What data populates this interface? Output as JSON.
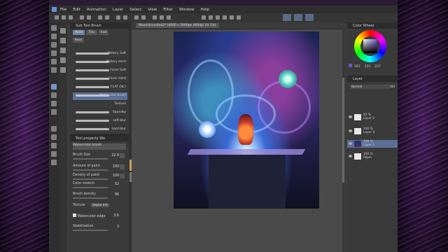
{
  "menu": [
    "File",
    "Edit",
    "Animation",
    "Layer",
    "Select",
    "View",
    "Filter",
    "Window",
    "Help"
  ],
  "subtool": {
    "title": "Sub Tool Brush",
    "tabs": [
      "Wate",
      "Thic",
      "Indi",
      "Real"
    ],
    "brushes": [
      {
        "label": "Watery Soft",
        "selected": false
      },
      {
        "label": "Watery Hard",
        "selected": false
      },
      {
        "label": "Fever Soft",
        "selected": false
      },
      {
        "label": "Fever Hard",
        "selected": false
      },
      {
        "label": "FLAT OIL?",
        "selected": false
      },
      {
        "label": "Watercolor brush",
        "selected": true
      },
      {
        "label": "Texture",
        "selected": false
      },
      {
        "label": "Squeaky",
        "selected": false
      },
      {
        "label": "soft blur",
        "selected": false
      },
      {
        "label": "hard blur",
        "selected": false
      }
    ]
  },
  "toolprop": {
    "title": "Tool property Wa",
    "brush_name": "Watercolor brush",
    "rows": [
      {
        "label": "Brush Size",
        "value": "22.0"
      },
      {
        "label": "Amount of paint",
        "value": "100"
      },
      {
        "label": "Density of paint",
        "value": "100"
      },
      {
        "label": "Color stretch",
        "value": "52"
      },
      {
        "label": "Brush density",
        "value": "96"
      },
      {
        "label": "Texture",
        "value": "Sepia ink"
      },
      {
        "label": "Watercolor edge",
        "value": "3.6"
      },
      {
        "label": "Stabilization",
        "value": "3"
      }
    ]
  },
  "document": {
    "tab_title": "Moonlitconstell2* (4000 x 5000px 400dpi 24.1%)"
  },
  "colorwheel": {
    "title": "Color Wheel",
    "rgb": [
      "181",
      "155",
      "237"
    ],
    "current_color": "#6a54c8"
  },
  "layers": {
    "title": "Layer",
    "mode": "Normal",
    "opacity": "100",
    "items": [
      {
        "pct": "92 %",
        "name": "Layer 2",
        "thumb": "white",
        "selected": false
      },
      {
        "pct": "100 %",
        "name": "Layer 4",
        "thumb": "white",
        "selected": false
      },
      {
        "pct": "100 %",
        "name": "Layer 1",
        "thumb": "white",
        "selected": true
      },
      {
        "pct": "100 %",
        "name": "Paper",
        "thumb": "white",
        "selected": false
      }
    ]
  }
}
